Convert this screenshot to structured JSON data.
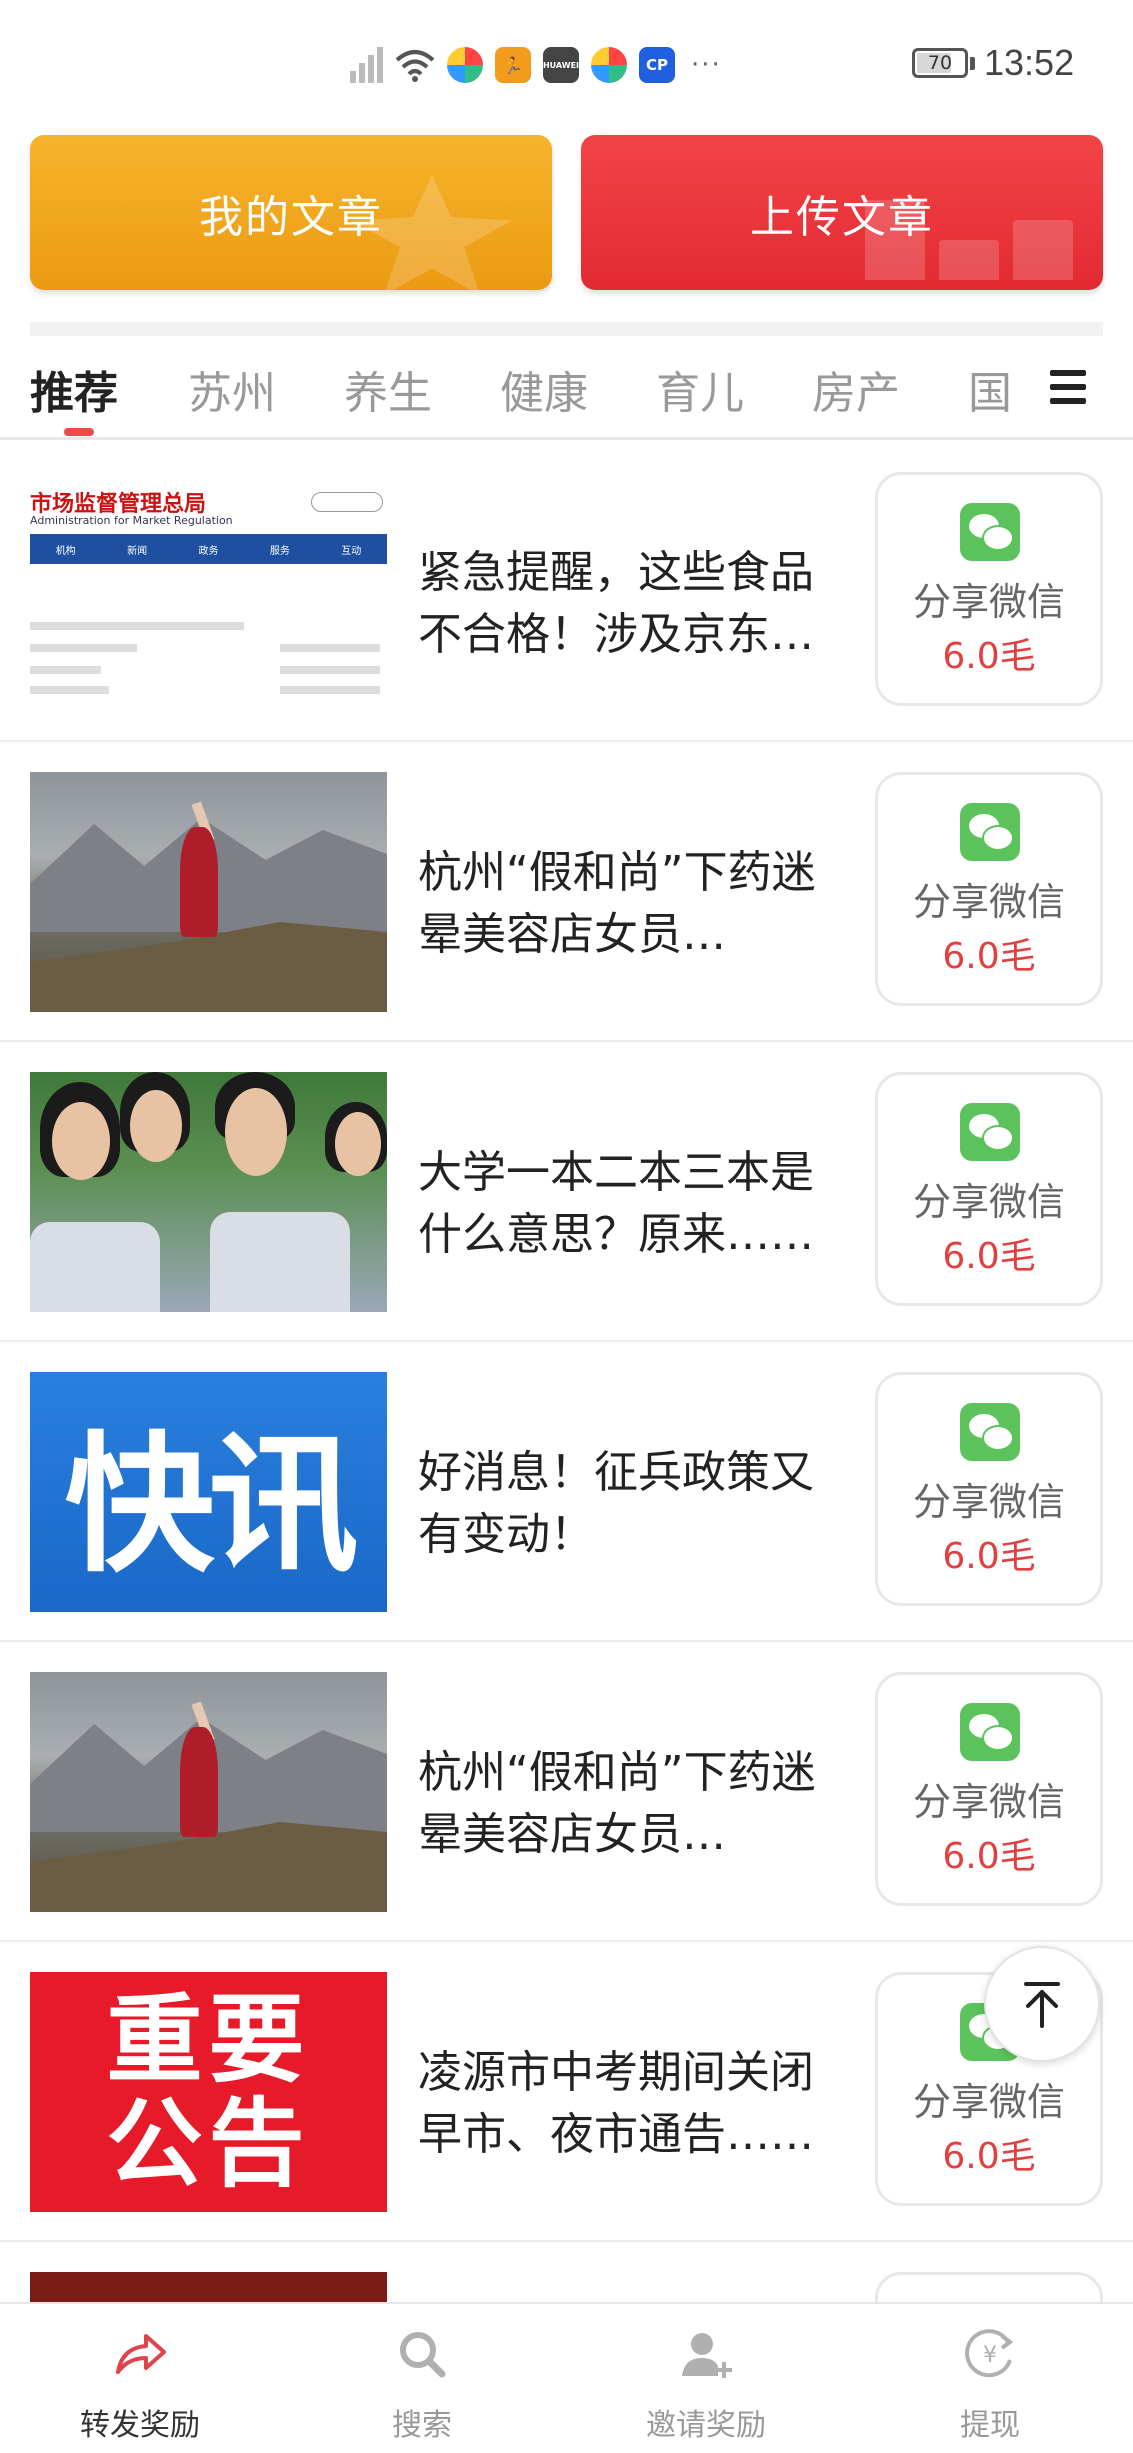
{
  "status_bar": {
    "time": "13:52",
    "battery": "70",
    "battery_level": 0.7,
    "overflow": "···",
    "app_icons": [
      "HUAWEI",
      "CP"
    ]
  },
  "actions": {
    "my_articles": "我的文章",
    "upload_article": "上传文章",
    "my_color": "#f0a81f",
    "upload_color": "#ec3339"
  },
  "tabs": {
    "items": [
      "推荐",
      "苏州",
      "养生",
      "健康",
      "育儿",
      "房产",
      "国"
    ],
    "active_index": 0,
    "accent": "#f04a4a"
  },
  "articles": [
    {
      "title": "紧急提醒，这些食品不合格！涉及京东、天猫、拼多多……",
      "thumb": {
        "type": "gov",
        "header": "市场监督管理总局",
        "subheader": "Administration for Market Regulation",
        "nav": [
          "机构",
          "新闻",
          "政务",
          "服务",
          "互动"
        ]
      },
      "share_label": "分享微信",
      "reward": "6.0毛"
    },
    {
      "title": "杭州“假和尚”下药迷晕美容店女员工：……",
      "thumb": {
        "type": "mountain"
      },
      "share_label": "分享微信",
      "reward": "6.0毛"
    },
    {
      "title": "大学一本二本三本是什么意思？原来……",
      "thumb": {
        "type": "students"
      },
      "share_label": "分享微信",
      "reward": "6.0毛"
    },
    {
      "title": "好消息！征兵政策又有变动！",
      "thumb": {
        "type": "news",
        "text": "快讯"
      },
      "share_label": "分享微信",
      "reward": "6.0毛"
    },
    {
      "title": "杭州“假和尚”下药迷晕美容店女员工：……",
      "thumb": {
        "type": "mountain"
      },
      "share_label": "分享微信",
      "reward": "6.0毛"
    },
    {
      "title": "凌源市中考期间关闭早市、夜市通告……",
      "thumb": {
        "type": "notice",
        "line1": "重要",
        "line2": "公告"
      },
      "share_label": "分享微信",
      "reward": "6.0毛"
    },
    {
      "title": "",
      "thumb": {
        "type": "banner"
      },
      "share_label": "",
      "reward": ""
    }
  ],
  "bottom_nav": [
    {
      "label": "转发奖励",
      "icon": "share-arrow-icon",
      "active": true
    },
    {
      "label": "搜索",
      "icon": "search-icon",
      "active": false
    },
    {
      "label": "邀请奖励",
      "icon": "add-user-icon",
      "active": false
    },
    {
      "label": "提现",
      "icon": "withdraw-yuan-icon",
      "active": false
    }
  ],
  "colors": {
    "accent_red": "#e24040",
    "wechat_green": "#5cc25c",
    "active_nav": "#e0444a",
    "inactive_nav": "#b0b0b0"
  }
}
